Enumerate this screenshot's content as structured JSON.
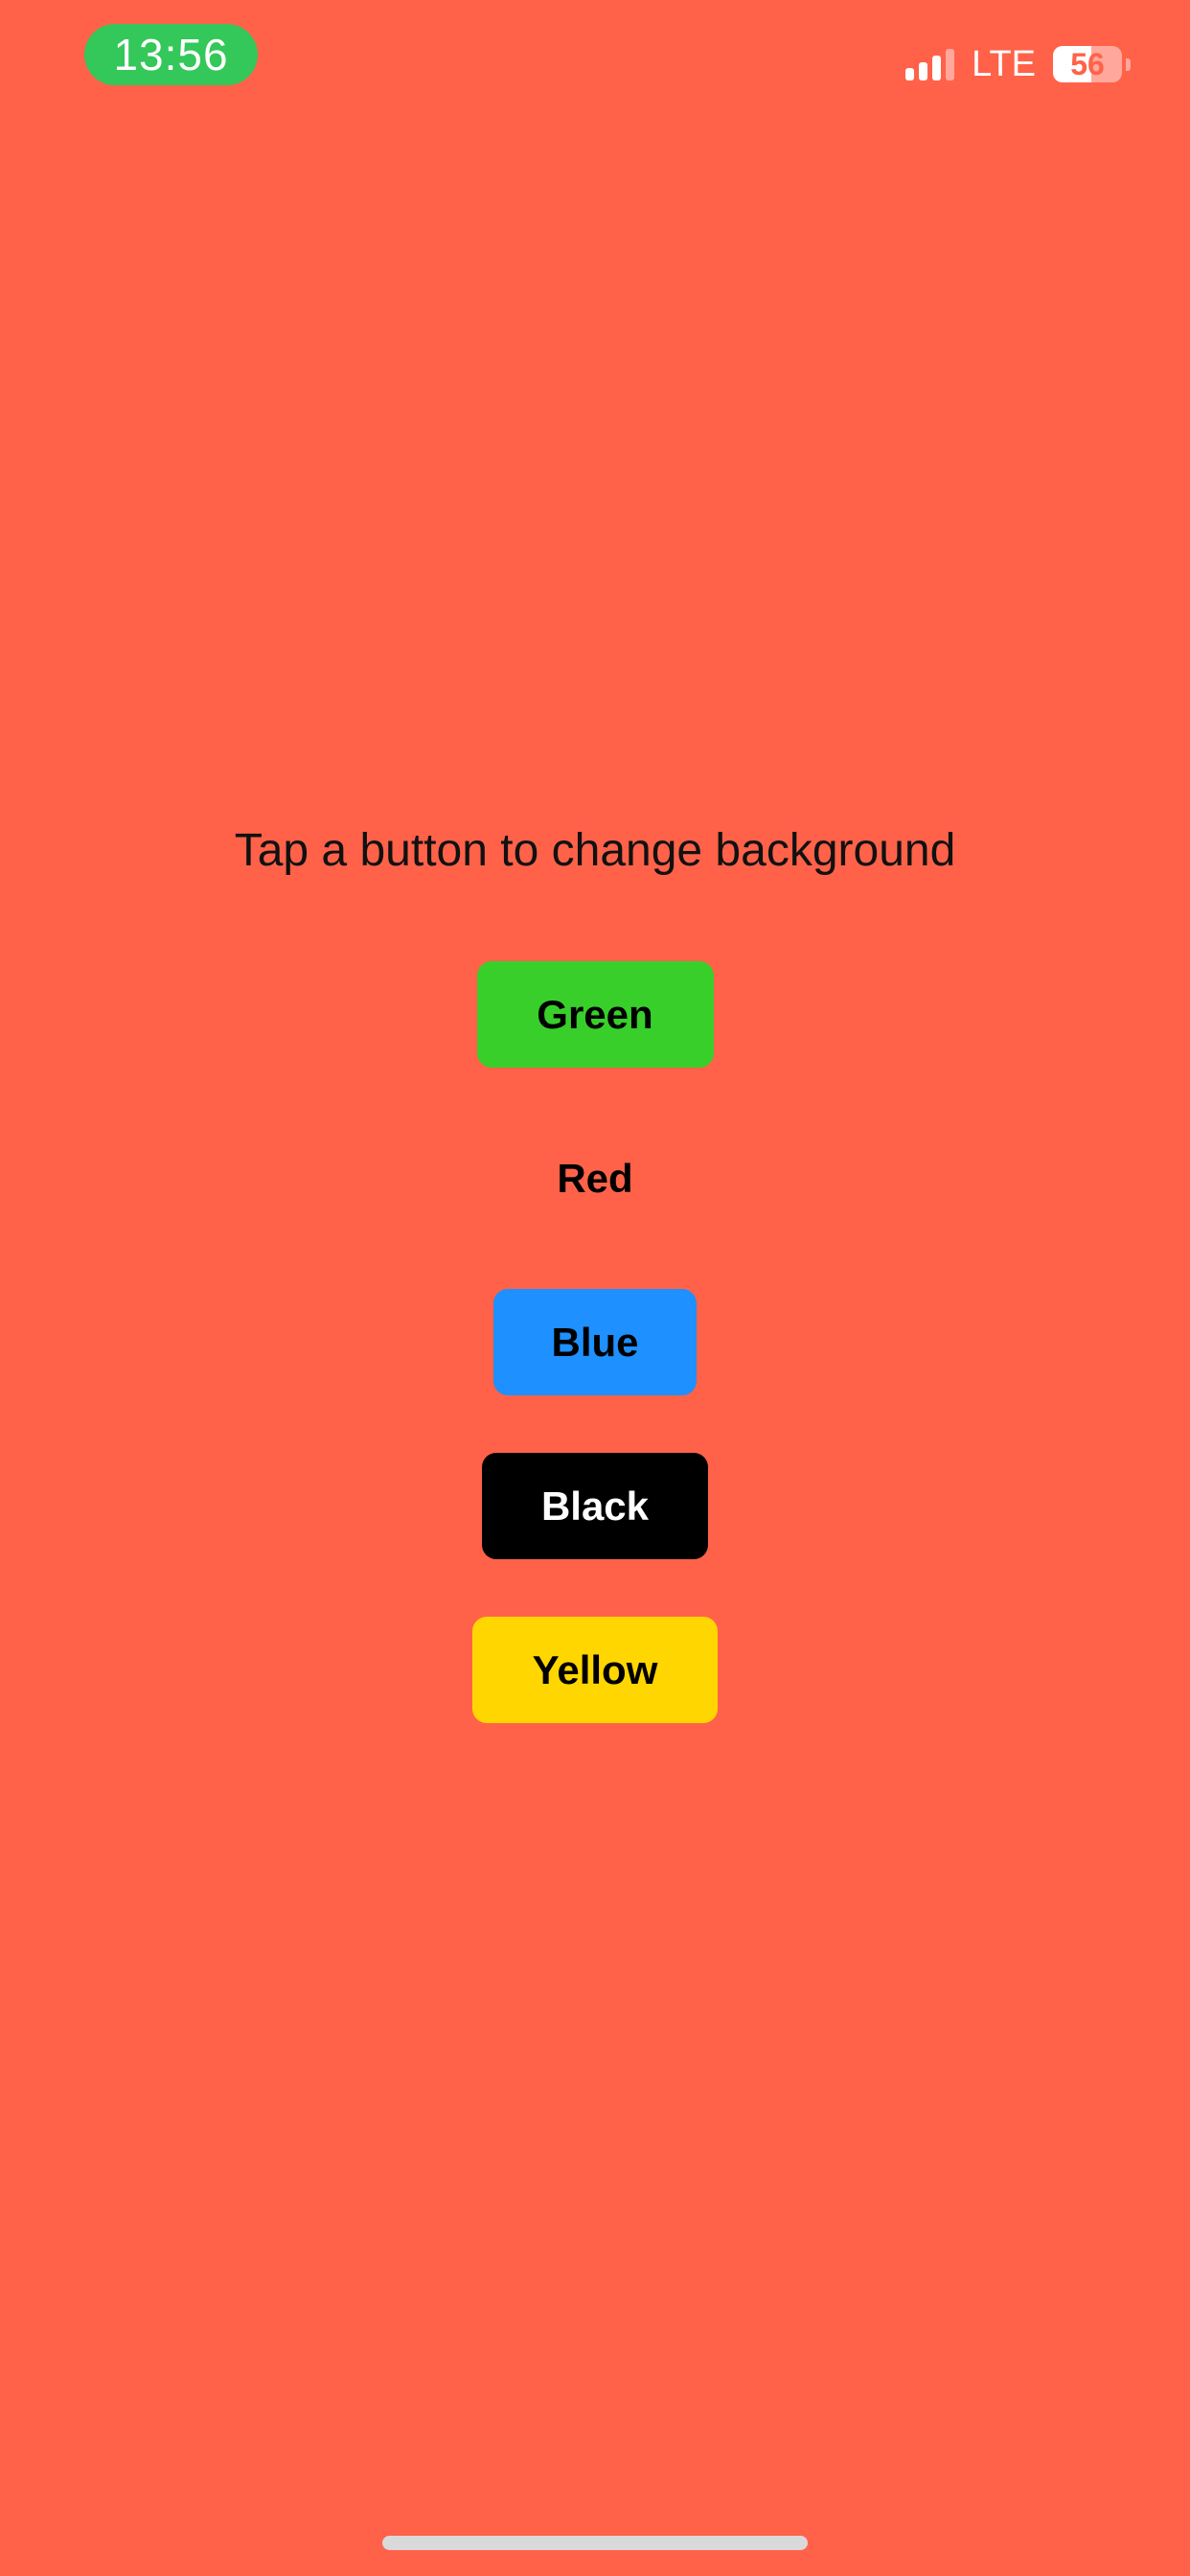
{
  "status_bar": {
    "time": "13:56",
    "network": "LTE",
    "battery_level": "56",
    "battery_fraction": 0.56,
    "signal_bars_active": 3,
    "signal_bars_total": 4,
    "time_pill_color": "#34c759"
  },
  "main": {
    "instruction": "Tap a button to change background",
    "background_color": "#ff6249",
    "buttons": [
      {
        "label": "Green",
        "color": "#38cf2b"
      },
      {
        "label": "Red",
        "color": "transparent"
      },
      {
        "label": "Blue",
        "color": "#1e90ff"
      },
      {
        "label": "Black",
        "color": "#000000"
      },
      {
        "label": "Yellow",
        "color": "#ffd600"
      }
    ]
  },
  "icons": {
    "signal": "cellular-signal-icon",
    "battery": "battery-icon"
  }
}
